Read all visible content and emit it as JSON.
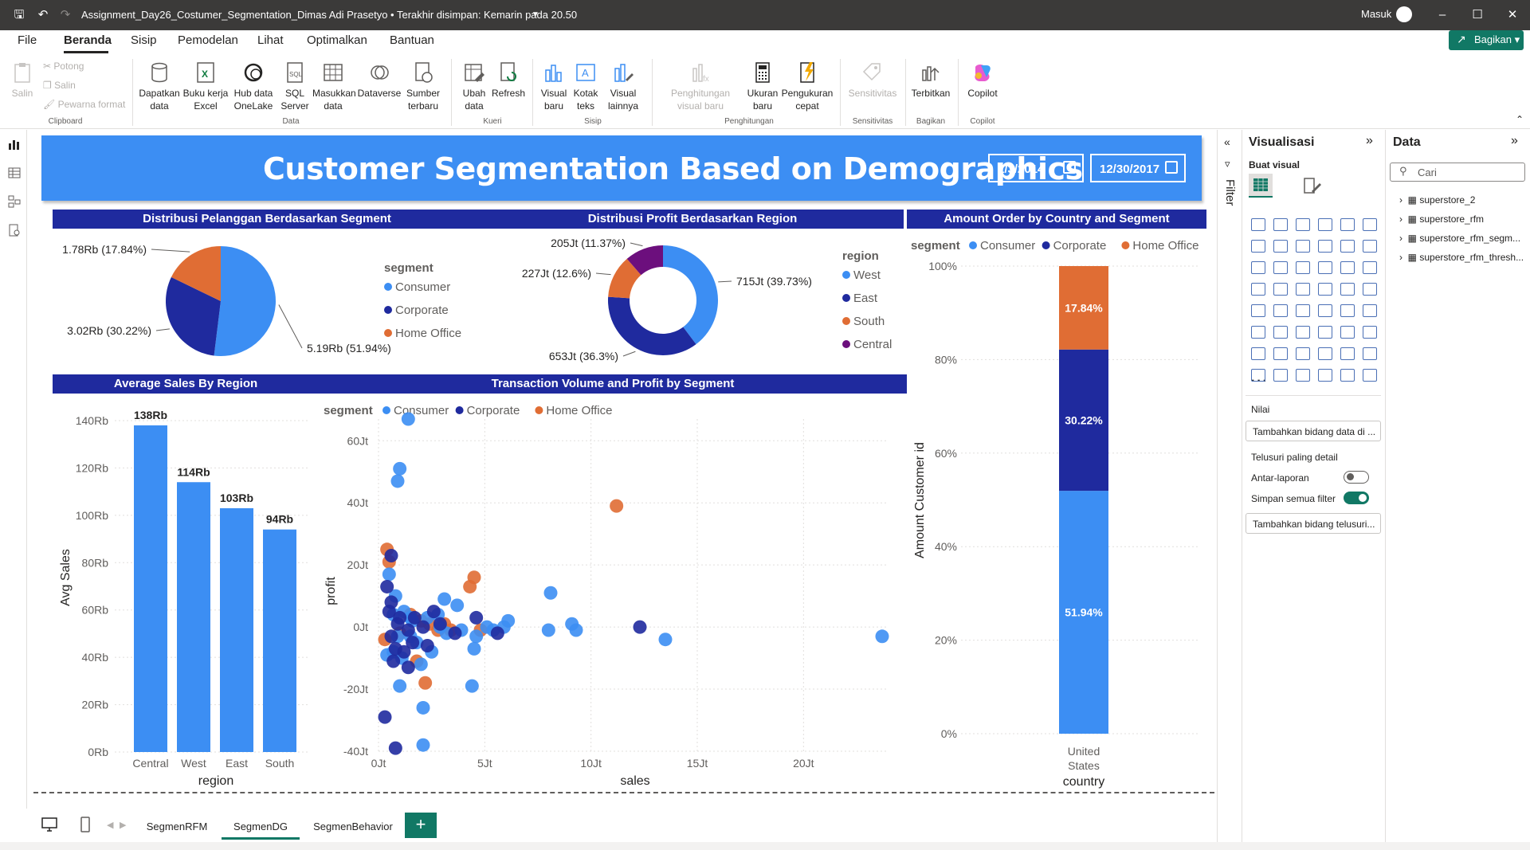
{
  "window": {
    "doc_title": "Assignment_Day26_Costumer_Segmentation_Dimas Adi Prasetyo • Terakhir disimpan: Kemarin pada 20.50",
    "signin": "Masuk"
  },
  "menu": {
    "items": [
      "File",
      "Beranda",
      "Sisip",
      "Pemodelan",
      "Lihat",
      "Optimalkan",
      "Bantuan"
    ],
    "active": "Beranda",
    "share_label": "Bagikan"
  },
  "ribbon": {
    "clipboard": {
      "paste": "Salin",
      "cut": "Potong",
      "copy": "Salin",
      "format_painter": "Pewarna format",
      "group": "Clipboard"
    },
    "data": {
      "get_data": "Dapatkan data",
      "excel": "Buku kerja Excel",
      "onelake": "Hub data OneLake",
      "sql": "SQL Server",
      "enter_data": "Masukkan data",
      "dataverse": "Dataverse",
      "recent": "Sumber terbaru",
      "group": "Data"
    },
    "queries": {
      "transform": "Ubah data",
      "refresh": "Refresh",
      "group": "Kueri"
    },
    "insert": {
      "new_visual": "Visual baru",
      "text_box": "Kotak teks",
      "more_visuals": "Visual lainnya",
      "group": "Sisip"
    },
    "calc": {
      "new_visual_calc": "Penghitungan visual baru",
      "new_measure": "Ukuran baru",
      "quick_measure": "Pengukuran cepat",
      "group": "Penghitungan"
    },
    "sensitivity": {
      "label": "Sensitivitas",
      "group": "Sensitivitas"
    },
    "share": {
      "publish": "Terbitkan",
      "group": "Bagikan"
    },
    "copilot": {
      "label": "Copilot",
      "group": "Copilot"
    }
  },
  "report": {
    "title": "Customer Segmentation Based on Demographics",
    "date_start": "1/3/2014",
    "date_end": "12/30/2017"
  },
  "visual_titles": {
    "pie": "Distribusi Pelanggan Berdasarkan Segment",
    "donut": "Distribusi Profit Berdasarkan Region",
    "stacked": "Amount Order by Country and Segment",
    "bar": "Average Sales By Region",
    "scatter": "Transaction Volume and Profit by Segment"
  },
  "colors": {
    "consumer": "#3c8ef3",
    "corporate": "#1f2a9e",
    "home_office": "#e06d34",
    "central": "#6c0f7d",
    "header_bar": "#1f2a9e",
    "banner": "#3c8ef3",
    "accent": "#117865"
  },
  "chart_data": [
    {
      "type": "pie",
      "title": "Distribusi Pelanggan Berdasarkan Segment",
      "legend_title": "segment",
      "slices": [
        {
          "name": "Consumer",
          "value": 5.19,
          "label": "5.19Rb (51.94%)"
        },
        {
          "name": "Corporate",
          "value": 3.02,
          "label": "3.02Rb (30.22%)"
        },
        {
          "name": "Home Office",
          "value": 1.78,
          "label": "1.78Rb (17.84%)"
        }
      ]
    },
    {
      "type": "pie",
      "subtype": "donut",
      "title": "Distribusi Profit Berdasarkan Region",
      "legend_title": "region",
      "slices": [
        {
          "name": "West",
          "value": 715,
          "label": "715Jt (39.73%)"
        },
        {
          "name": "East",
          "value": 653,
          "label": "653Jt (36.3%)"
        },
        {
          "name": "South",
          "value": 227,
          "label": "227Jt (12.6%)"
        },
        {
          "name": "Central",
          "value": 205,
          "label": "205Jt (11.37%)"
        }
      ]
    },
    {
      "type": "bar",
      "subtype": "stacked-100",
      "title": "Amount Order by Country and Segment",
      "legend_title": "segment",
      "xlabel": "country",
      "ylabel": "Amount Customer id",
      "categories": [
        "United States"
      ],
      "series": [
        {
          "name": "Consumer",
          "values": [
            51.94
          ],
          "label": "51.94%"
        },
        {
          "name": "Corporate",
          "values": [
            30.22
          ],
          "label": "30.22%"
        },
        {
          "name": "Home Office",
          "values": [
            17.84
          ],
          "label": "17.84%"
        }
      ],
      "yticks": [
        "0%",
        "20%",
        "40%",
        "60%",
        "80%",
        "100%"
      ]
    },
    {
      "type": "bar",
      "title": "Average Sales By Region",
      "xlabel": "region",
      "ylabel": "Avg Sales",
      "categories": [
        "Central",
        "West",
        "East",
        "South"
      ],
      "values": [
        138,
        114,
        103,
        94
      ],
      "labels": [
        "138Rb",
        "114Rb",
        "103Rb",
        "94Rb"
      ],
      "ylim": [
        0,
        140
      ],
      "yticks": [
        "0Rb",
        "20Rb",
        "40Rb",
        "60Rb",
        "80Rb",
        "100Rb",
        "120Rb",
        "140Rb"
      ]
    },
    {
      "type": "scatter",
      "title": "Transaction Volume and Profit by Segment",
      "legend_title": "segment",
      "xlabel": "sales",
      "ylabel": "profit",
      "xticks": [
        "0Jt",
        "5Jt",
        "10Jt",
        "15Jt",
        "20Jt"
      ],
      "yticks": [
        "-40Jt",
        "-20Jt",
        "0Jt",
        "20Jt",
        "40Jt",
        "60Jt"
      ],
      "xlim": [
        0,
        24
      ],
      "ylim": [
        -40,
        67
      ],
      "series": [
        {
          "name": "Consumer",
          "points": [
            [
              1.4,
              67
            ],
            [
              1.0,
              51
            ],
            [
              0.9,
              47
            ],
            [
              0.5,
              17
            ],
            [
              0.8,
              10
            ],
            [
              1.2,
              5
            ],
            [
              1.5,
              3
            ],
            [
              0.9,
              -3
            ],
            [
              1.8,
              -5
            ],
            [
              2.5,
              -8
            ],
            [
              2.0,
              -12
            ],
            [
              1.5,
              -3
            ],
            [
              0.7,
              4
            ],
            [
              1.1,
              -10
            ],
            [
              1.0,
              -19
            ],
            [
              2.1,
              -26
            ],
            [
              2.1,
              -38
            ],
            [
              4.4,
              -19
            ],
            [
              4.5,
              -7
            ],
            [
              4.6,
              -3
            ],
            [
              3.9,
              -1
            ],
            [
              3.2,
              -2
            ],
            [
              5.1,
              0
            ],
            [
              5.9,
              0
            ],
            [
              6.1,
              2
            ],
            [
              8.1,
              11
            ],
            [
              8.0,
              -1
            ],
            [
              9.1,
              1
            ],
            [
              9.3,
              -1
            ],
            [
              13.5,
              -4
            ],
            [
              23.7,
              -3
            ],
            [
              3.1,
              9
            ],
            [
              3.7,
              7
            ],
            [
              2.8,
              4
            ],
            [
              2.3,
              3
            ],
            [
              5.4,
              -1
            ],
            [
              0.7,
              -8
            ],
            [
              0.4,
              -9
            ],
            [
              1.6,
              2
            ],
            [
              2.9,
              0
            ]
          ]
        },
        {
          "name": "Corporate",
          "points": [
            [
              0.6,
              23
            ],
            [
              0.4,
              13
            ],
            [
              0.6,
              8
            ],
            [
              0.5,
              5
            ],
            [
              0.9,
              1
            ],
            [
              1.4,
              -1
            ],
            [
              1.7,
              3
            ],
            [
              2.3,
              -6
            ],
            [
              2.9,
              1
            ],
            [
              1.2,
              -8
            ],
            [
              0.7,
              -11
            ],
            [
              0.3,
              -29
            ],
            [
              0.8,
              -39
            ],
            [
              1.4,
              -13
            ],
            [
              2.1,
              0
            ],
            [
              3.6,
              -2
            ],
            [
              4.6,
              3
            ],
            [
              5.6,
              -2
            ],
            [
              12.3,
              0
            ],
            [
              0.6,
              -3
            ],
            [
              1.0,
              3
            ],
            [
              1.6,
              -5
            ],
            [
              0.8,
              -7
            ],
            [
              2.6,
              5
            ]
          ]
        },
        {
          "name": "Home Office",
          "points": [
            [
              0.4,
              25
            ],
            [
              0.5,
              21
            ],
            [
              4.5,
              16
            ],
            [
              4.3,
              13
            ],
            [
              11.2,
              39
            ],
            [
              2.2,
              -18
            ],
            [
              1.8,
              -11
            ],
            [
              0.3,
              -4
            ],
            [
              1.5,
              4
            ],
            [
              3.1,
              1
            ],
            [
              3.4,
              -1
            ],
            [
              4.8,
              -1
            ],
            [
              2.4,
              1
            ],
            [
              1.0,
              -2
            ],
            [
              2.8,
              -1
            ],
            [
              2.0,
              2
            ]
          ]
        }
      ]
    }
  ],
  "tabs": [
    "SegmenRFM",
    "SegmenDG",
    "SegmenBehavior"
  ],
  "active_tab": "SegmenDG",
  "filter_label": "Filter",
  "viz_pane": {
    "title": "Visualisasi",
    "build_visual": "Buat visual",
    "values_label": "Nilai",
    "add_data_field": "Tambahkan bidang data di ...",
    "drillthrough": "Telusuri paling detail",
    "cross_report": "Antar-laporan",
    "keep_filters": "Simpan semua filter",
    "add_drill_field": "Tambahkan bidang telusuri..."
  },
  "data_pane": {
    "title": "Data",
    "search_placeholder": "Cari",
    "tables": [
      "superstore_2",
      "superstore_rfm",
      "superstore_rfm_segm...",
      "superstore_rfm_thresh..."
    ]
  }
}
